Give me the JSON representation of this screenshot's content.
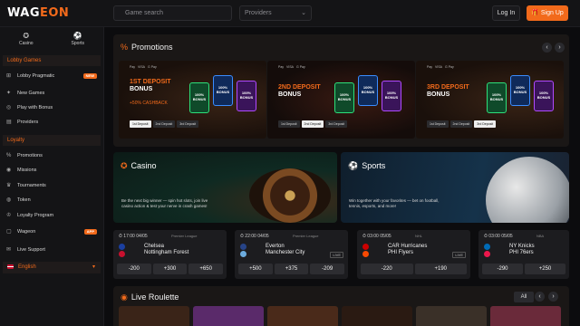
{
  "header": {
    "logo_a": "WAG",
    "logo_b": "EON",
    "search_placeholder": "Game search",
    "providers_label": "Providers",
    "login_label": "Log In",
    "signup_label": "Sign Up"
  },
  "sidebar": {
    "top": [
      {
        "label": "Casino",
        "icon": "casino-icon"
      },
      {
        "label": "Sports",
        "icon": "sports-icon"
      }
    ],
    "lobby_section": "Lobby Games",
    "lobby_items": [
      {
        "label": "Lobby Pragmatic",
        "badge": "NEW"
      },
      {
        "label": "New Games"
      },
      {
        "label": "Play with Bonus"
      },
      {
        "label": "Providers"
      }
    ],
    "loyalty_section": "Loyalty",
    "loyalty_items": [
      {
        "label": "Promotions"
      },
      {
        "label": "Missions"
      },
      {
        "label": "Tournaments"
      },
      {
        "label": "Token"
      },
      {
        "label": "Loyalty Program"
      },
      {
        "label": "Wageon",
        "badge": "APP"
      },
      {
        "label": "Live Support"
      }
    ],
    "language": "English"
  },
  "promotions": {
    "title": "Promotions",
    "cards": [
      {
        "line1": "1ST DEPOSIT",
        "line2": "BONUS",
        "extra": "+50% CASHBACK",
        "tabs": [
          "1st Deposit",
          "2nd Deposit",
          "3rd Deposit"
        ],
        "active": 0
      },
      {
        "line1": "2ND DEPOSIT",
        "line2": "BONUS",
        "extra": "",
        "tabs": [
          "1st Deposit",
          "2nd Deposit",
          "3rd Deposit"
        ],
        "active": 1
      },
      {
        "line1": "3RD DEPOSIT",
        "line2": "BONUS",
        "extra": "",
        "tabs": [
          "1st Deposit",
          "2nd Deposit",
          "3rd Deposit"
        ],
        "active": 2
      }
    ],
    "pays": [
      "Pay",
      "VISA",
      "G Pay"
    ],
    "bonus_cards": [
      "100% BONUS",
      "100% BONUS",
      "100% BONUS"
    ]
  },
  "casino": {
    "title": "Casino",
    "desc": "Be the next big winner — spin hot slots, join live casino action & test your nerve in crash games!"
  },
  "sports": {
    "title": "Sports",
    "desc": "Win together with your favorites — bet on football, tennis, esports, and more!"
  },
  "matches": [
    {
      "time": "17:00",
      "date": "04/05",
      "league": "Premier League",
      "team1": "Chelsea",
      "team2": "Nottingham Forest",
      "odds": [
        "-200",
        "+300",
        "+650"
      ],
      "live": false,
      "c1": "#1b3fa0",
      "c2": "#c8102e"
    },
    {
      "time": "22:00",
      "date": "04/05",
      "league": "Premier League",
      "team1": "Everton",
      "team2": "Manchester City",
      "odds": [
        "+500",
        "+375",
        "-209"
      ],
      "live": true,
      "live_label": "LIVE",
      "c1": "#274488",
      "c2": "#6cabdd"
    },
    {
      "time": "03:00",
      "date": "05/05",
      "league": "NHL",
      "team1": "CAR Hurricanes",
      "team2": "PHI Flyers",
      "odds": [
        "-220",
        "+190"
      ],
      "live": true,
      "live_label": "LIVE",
      "c1": "#cc0000",
      "c2": "#f74902"
    },
    {
      "time": "03:00",
      "date": "05/05",
      "league": "NBA",
      "team1": "NY Knicks",
      "team2": "PHI 76ers",
      "odds": [
        "-290",
        "+250"
      ],
      "live": false,
      "c1": "#006bb6",
      "c2": "#ed174c"
    }
  ],
  "roulette": {
    "title": "Live Roulette",
    "all_label": "All"
  },
  "colors": {
    "accent": "#f26a1b",
    "bg": "#0c0c0e",
    "panel": "#1a1716"
  }
}
